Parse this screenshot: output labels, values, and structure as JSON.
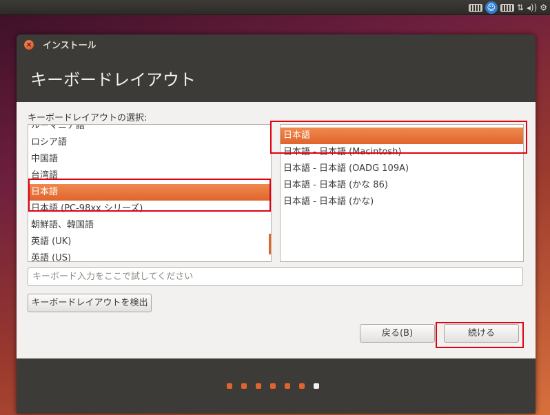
{
  "window": {
    "title": "インストール",
    "close_symbol": "×",
    "page_title": "キーボードレイアウト"
  },
  "tray": {
    "icons": [
      "keyboard-icon",
      "accessibility-icon",
      "keyboard-icon",
      "network-icon",
      "volume-icon",
      "gear-icon"
    ],
    "accessibility_glyph": "☺",
    "network_glyph": "⇅",
    "volume_glyph": "◂))",
    "gear_glyph": "⚙"
  },
  "layout_section": {
    "label": "キーボードレイアウトの選択:"
  },
  "layouts": {
    "items": [
      "ルーマニア語",
      "ロシア語",
      "中国語",
      "台湾語",
      "日本語",
      "日本語 (PC-98xx シリーズ)",
      "朝鮮語、韓国語",
      "英語 (UK)",
      "英語 (US)"
    ],
    "selected_index": 4
  },
  "variants": {
    "items": [
      "日本語",
      "日本語 - 日本語 (Macintosh)",
      "日本語 - 日本語 (OADG 109A)",
      "日本語 - 日本語 (かな 86)",
      "日本語 - 日本語 (かな)"
    ],
    "selected_index": 0
  },
  "test_input": {
    "placeholder": "キーボード入力をここで試してください",
    "value": ""
  },
  "buttons": {
    "detect": "キーボードレイアウトを検出",
    "back": "戻る(B)",
    "continue": "続ける"
  },
  "progress": {
    "total_steps": 7,
    "current_step": 7
  },
  "colors": {
    "accent": "#e0652c",
    "highlight_box": "#e00012",
    "panel": "#3c3b37"
  }
}
